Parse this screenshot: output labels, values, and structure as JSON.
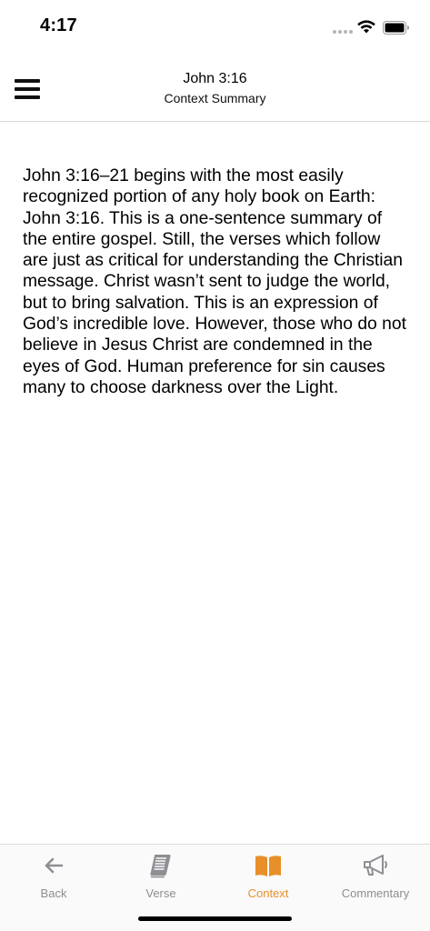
{
  "status_bar": {
    "time": "4:17"
  },
  "header": {
    "title": "John 3:16",
    "subtitle": "Context Summary"
  },
  "content": {
    "summary": "John 3:16–21 begins with the most easily recognized portion of any holy book on Earth: John 3:16. This is a one-sentence summary of the entire gospel. Still, the verses which follow are just as critical for understanding the Christian message. Christ wasn’t sent to judge the world, but to bring salvation. This is an expression of God’s incredible love. However, those who do not believe in Jesus Christ are condemned in the eyes of God. Human preference for sin causes many to choose darkness over the Light."
  },
  "tab_bar": {
    "tabs": [
      {
        "label": "Back",
        "icon": "arrow-left-icon",
        "active": false
      },
      {
        "label": "Verse",
        "icon": "book-icon",
        "active": false
      },
      {
        "label": "Context",
        "icon": "open-book-icon",
        "active": true
      },
      {
        "label": "Commentary",
        "icon": "megaphone-icon",
        "active": false
      }
    ]
  },
  "colors": {
    "accent": "#e88f2a",
    "inactive": "#8e8e93",
    "divider": "#d8d8d8"
  }
}
